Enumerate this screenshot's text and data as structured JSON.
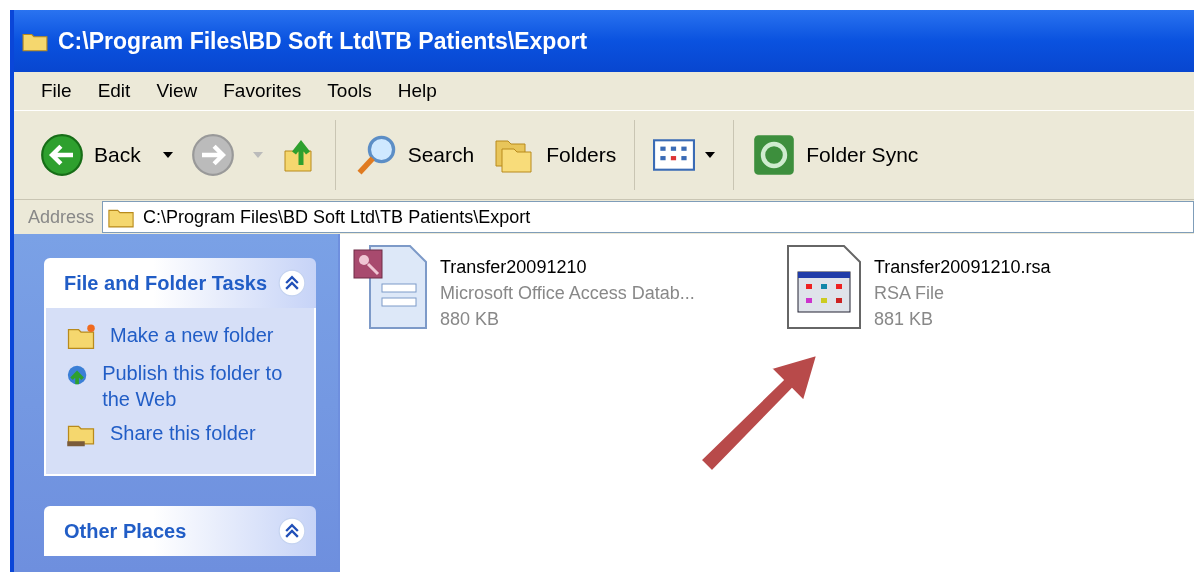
{
  "window": {
    "title": "C:\\Program Files\\BD Soft Ltd\\TB Patients\\Export"
  },
  "menu": [
    "File",
    "Edit",
    "View",
    "Favorites",
    "Tools",
    "Help"
  ],
  "toolbar": {
    "back": "Back",
    "search": "Search",
    "folders": "Folders",
    "sync": "Folder Sync"
  },
  "address": {
    "label": "Address",
    "value": "C:\\Program Files\\BD Soft Ltd\\TB Patients\\Export"
  },
  "task_panels": [
    {
      "title": "File and Folder Tasks",
      "expanded": true,
      "items": [
        {
          "kind": "newfolder",
          "label": "Make a new folder"
        },
        {
          "kind": "publish",
          "label": "Publish this folder to the Web"
        },
        {
          "kind": "share",
          "label": "Share this folder"
        }
      ]
    },
    {
      "title": "Other Places",
      "expanded": true
    }
  ],
  "files": [
    {
      "kind": "access",
      "name": "Transfer20091210",
      "type": "Microsoft Office Access Datab...",
      "size": "880 KB"
    },
    {
      "kind": "rsa",
      "name": "Transfer20091210.rsa",
      "type": "RSA File",
      "size": "881 KB"
    }
  ]
}
